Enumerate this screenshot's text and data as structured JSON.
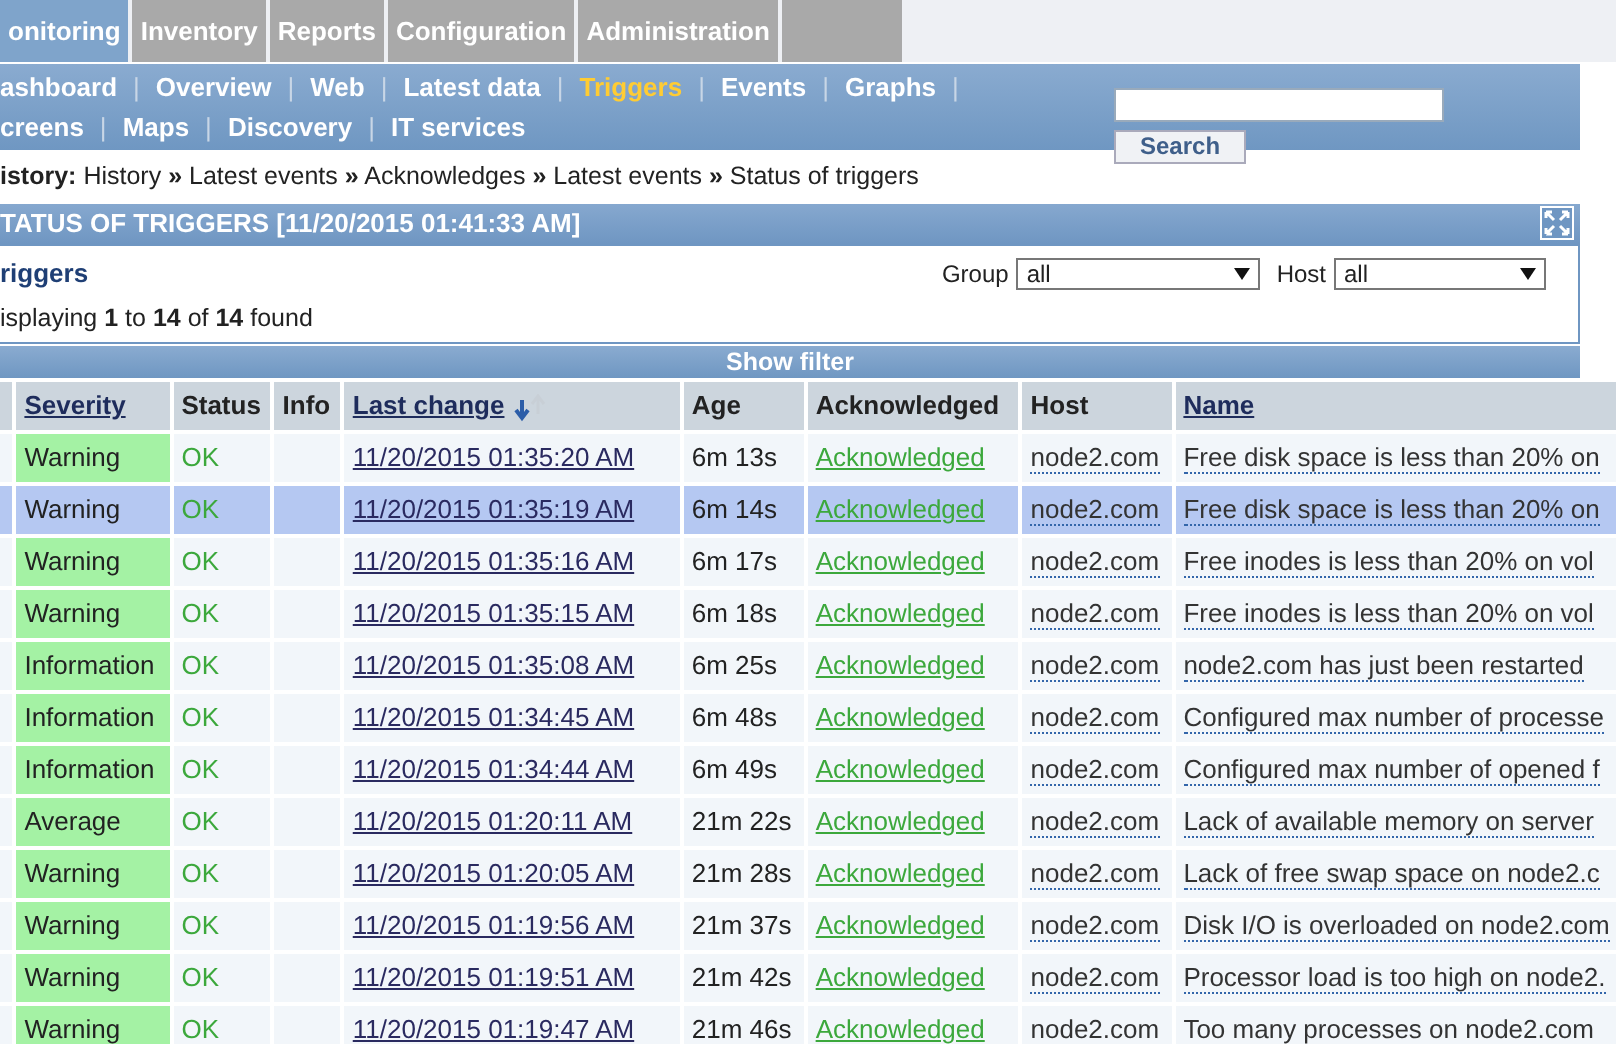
{
  "main_tabs": [
    {
      "label": "onitoring",
      "selected": true
    },
    {
      "label": "Inventory",
      "selected": false
    },
    {
      "label": "Reports",
      "selected": false
    },
    {
      "label": "Configuration",
      "selected": false
    },
    {
      "label": "Administration",
      "selected": false
    }
  ],
  "sub_menu": {
    "separator": "|",
    "rows": [
      {
        "trailing_separator": true,
        "items": [
          {
            "label": "ashboard",
            "selected": false
          },
          {
            "label": "Overview",
            "selected": false
          },
          {
            "label": "Web",
            "selected": false
          },
          {
            "label": "Latest data",
            "selected": false
          },
          {
            "label": "Triggers",
            "selected": true
          },
          {
            "label": "Events",
            "selected": false
          },
          {
            "label": "Graphs",
            "selected": false
          }
        ]
      },
      {
        "trailing_separator": false,
        "items": [
          {
            "label": "creens",
            "selected": false
          },
          {
            "label": "Maps",
            "selected": false
          },
          {
            "label": "Discovery",
            "selected": false
          },
          {
            "label": "IT services",
            "selected": false
          }
        ]
      }
    ]
  },
  "search": {
    "button": "Search"
  },
  "breadcrumb": {
    "label": "istory:",
    "items": [
      "History",
      "Latest events",
      "Acknowledges",
      "Latest events",
      "Status of triggers"
    ],
    "separator": "»"
  },
  "title_bar": {
    "title": "TATUS OF TRIGGERS [11/20/2015 01:41:33 AM]"
  },
  "filter_box": {
    "heading": "riggers",
    "group_label": "Group",
    "group_value": "all",
    "host_label": "Host",
    "host_value": "all",
    "summary": "isplaying **1** to **14** of **14** found",
    "toggle": "Show filter"
  },
  "table": {
    "columns": [
      {
        "label": "Severity",
        "sortable": true
      },
      {
        "label": "Status",
        "sortable": false
      },
      {
        "label": "Info",
        "sortable": false
      },
      {
        "label": "Last change",
        "sortable": true
      },
      {
        "label": "Age",
        "sortable": false
      },
      {
        "label": "Acknowledged",
        "sortable": false
      },
      {
        "label": "Host",
        "sortable": false
      },
      {
        "label": "Name",
        "sortable": true
      }
    ],
    "rows": [
      {
        "severity": "Warning",
        "status": "OK",
        "last_change": "11/20/2015 01:35:20 AM",
        "age": "6m 13s",
        "acknowledged": "Acknowledged",
        "host": "node2.com",
        "name": "Free disk space is less than 20% on",
        "selected": false
      },
      {
        "severity": "Warning",
        "status": "OK",
        "last_change": "11/20/2015 01:35:19 AM",
        "age": "6m 14s",
        "acknowledged": "Acknowledged",
        "host": "node2.com",
        "name": "Free disk space is less than 20% on",
        "selected": true
      },
      {
        "severity": "Warning",
        "status": "OK",
        "last_change": "11/20/2015 01:35:16 AM",
        "age": "6m 17s",
        "acknowledged": "Acknowledged",
        "host": "node2.com",
        "name": "Free inodes is less than 20% on vol",
        "selected": false
      },
      {
        "severity": "Warning",
        "status": "OK",
        "last_change": "11/20/2015 01:35:15 AM",
        "age": "6m 18s",
        "acknowledged": "Acknowledged",
        "host": "node2.com",
        "name": "Free inodes is less than 20% on vol",
        "selected": false
      },
      {
        "severity": "Information",
        "status": "OK",
        "last_change": "11/20/2015 01:35:08 AM",
        "age": "6m 25s",
        "acknowledged": "Acknowledged",
        "host": "node2.com",
        "name": "node2.com has just been restarted",
        "selected": false
      },
      {
        "severity": "Information",
        "status": "OK",
        "last_change": "11/20/2015 01:34:45 AM",
        "age": "6m 48s",
        "acknowledged": "Acknowledged",
        "host": "node2.com",
        "name": "Configured max number of processe",
        "selected": false
      },
      {
        "severity": "Information",
        "status": "OK",
        "last_change": "11/20/2015 01:34:44 AM",
        "age": "6m 49s",
        "acknowledged": "Acknowledged",
        "host": "node2.com",
        "name": "Configured max number of opened f",
        "selected": false
      },
      {
        "severity": "Average",
        "status": "OK",
        "last_change": "11/20/2015 01:20:11 AM",
        "age": "21m 22s",
        "acknowledged": "Acknowledged",
        "host": "node2.com",
        "name": "Lack of available memory on server",
        "selected": false
      },
      {
        "severity": "Warning",
        "status": "OK",
        "last_change": "11/20/2015 01:20:05 AM",
        "age": "21m 28s",
        "acknowledged": "Acknowledged",
        "host": "node2.com",
        "name": "Lack of free swap space on node2.c",
        "selected": false
      },
      {
        "severity": "Warning",
        "status": "OK",
        "last_change": "11/20/2015 01:19:56 AM",
        "age": "21m 37s",
        "acknowledged": "Acknowledged",
        "host": "node2.com",
        "name": "Disk I/O is overloaded on node2.com",
        "selected": false
      },
      {
        "severity": "Warning",
        "status": "OK",
        "last_change": "11/20/2015 01:19:51 AM",
        "age": "21m 42s",
        "acknowledged": "Acknowledged",
        "host": "node2.com",
        "name": "Processor load is too high on node2.",
        "selected": false
      },
      {
        "severity": "Warning",
        "status": "OK",
        "last_change": "11/20/2015 01:19:47 AM",
        "age": "21m 46s",
        "acknowledged": "Acknowledged",
        "host": "node2.com",
        "name": "Too many processes on node2.com",
        "selected": false
      }
    ]
  }
}
